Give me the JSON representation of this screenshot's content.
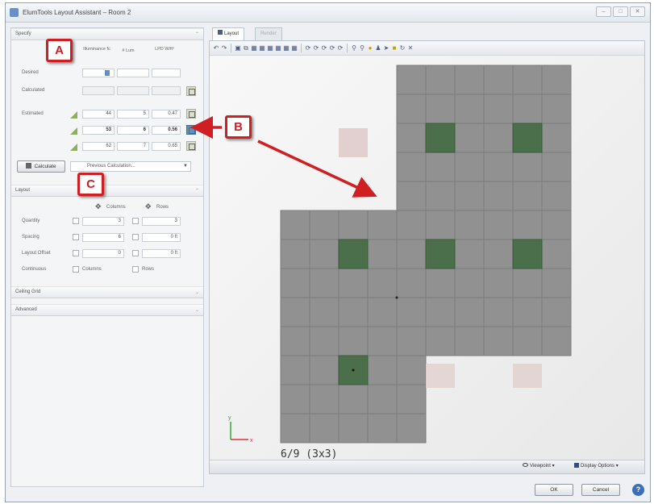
{
  "window": {
    "title": "ElumTools Layout Assistant – Room 2",
    "controls": [
      "–",
      "□",
      "✕"
    ]
  },
  "specify": {
    "header": "Specify",
    "columns": [
      "Illuminance fc",
      "# Lum",
      "LPD W/ft²"
    ],
    "rows": {
      "desired": {
        "label": "Desired",
        "illuminance": "",
        "lum": "",
        "lpd": ""
      },
      "calculated": {
        "label": "Calculated",
        "illuminance": "",
        "lum": "",
        "lpd": ""
      },
      "estimated": [
        {
          "label": "Estimated",
          "illuminance": "44",
          "lum": "5",
          "lpd": "0.47"
        },
        {
          "label": "",
          "illuminance": "53",
          "lum": "6",
          "lpd": "0.56"
        },
        {
          "label": "",
          "illuminance": "62",
          "lum": "7",
          "lpd": "0.65"
        }
      ]
    },
    "calculate_button": "Calculate",
    "previous_calc_dropdown": "Previous Calculation..."
  },
  "layout": {
    "header": "Layout",
    "columns_label": "Columns",
    "rows_label": "Rows",
    "quantity": {
      "label": "Quantity",
      "columns": "3",
      "rows": "3"
    },
    "spacing": {
      "label": "Spacing",
      "columns": "6",
      "rows": "0 ft"
    },
    "layout_offset": {
      "label": "Layout Offset",
      "columns": "0",
      "rows": "0 ft"
    },
    "continuous": {
      "label": "Continuous",
      "columns_option": "Columns",
      "rows_option": "Rows"
    }
  },
  "collapsed_sections": [
    "Ceiling Grid",
    "Advanced"
  ],
  "viewport": {
    "tabs": [
      "Layout",
      "Render"
    ],
    "active_tab": "Layout",
    "grid_label": "6/9  (3x3)",
    "status_viewpoint": "Viewpoint",
    "status_display_options": "Display Options"
  },
  "buttons": {
    "ok": "OK",
    "cancel": "Cancel",
    "help": "?"
  },
  "callouts": [
    "A",
    "B",
    "C"
  ],
  "colors": {
    "accent_red": "#d01f23",
    "ceiling_tile": "#919191",
    "luminaire": "#4b6f4b",
    "highlight_blue": "#5b8fc9"
  }
}
